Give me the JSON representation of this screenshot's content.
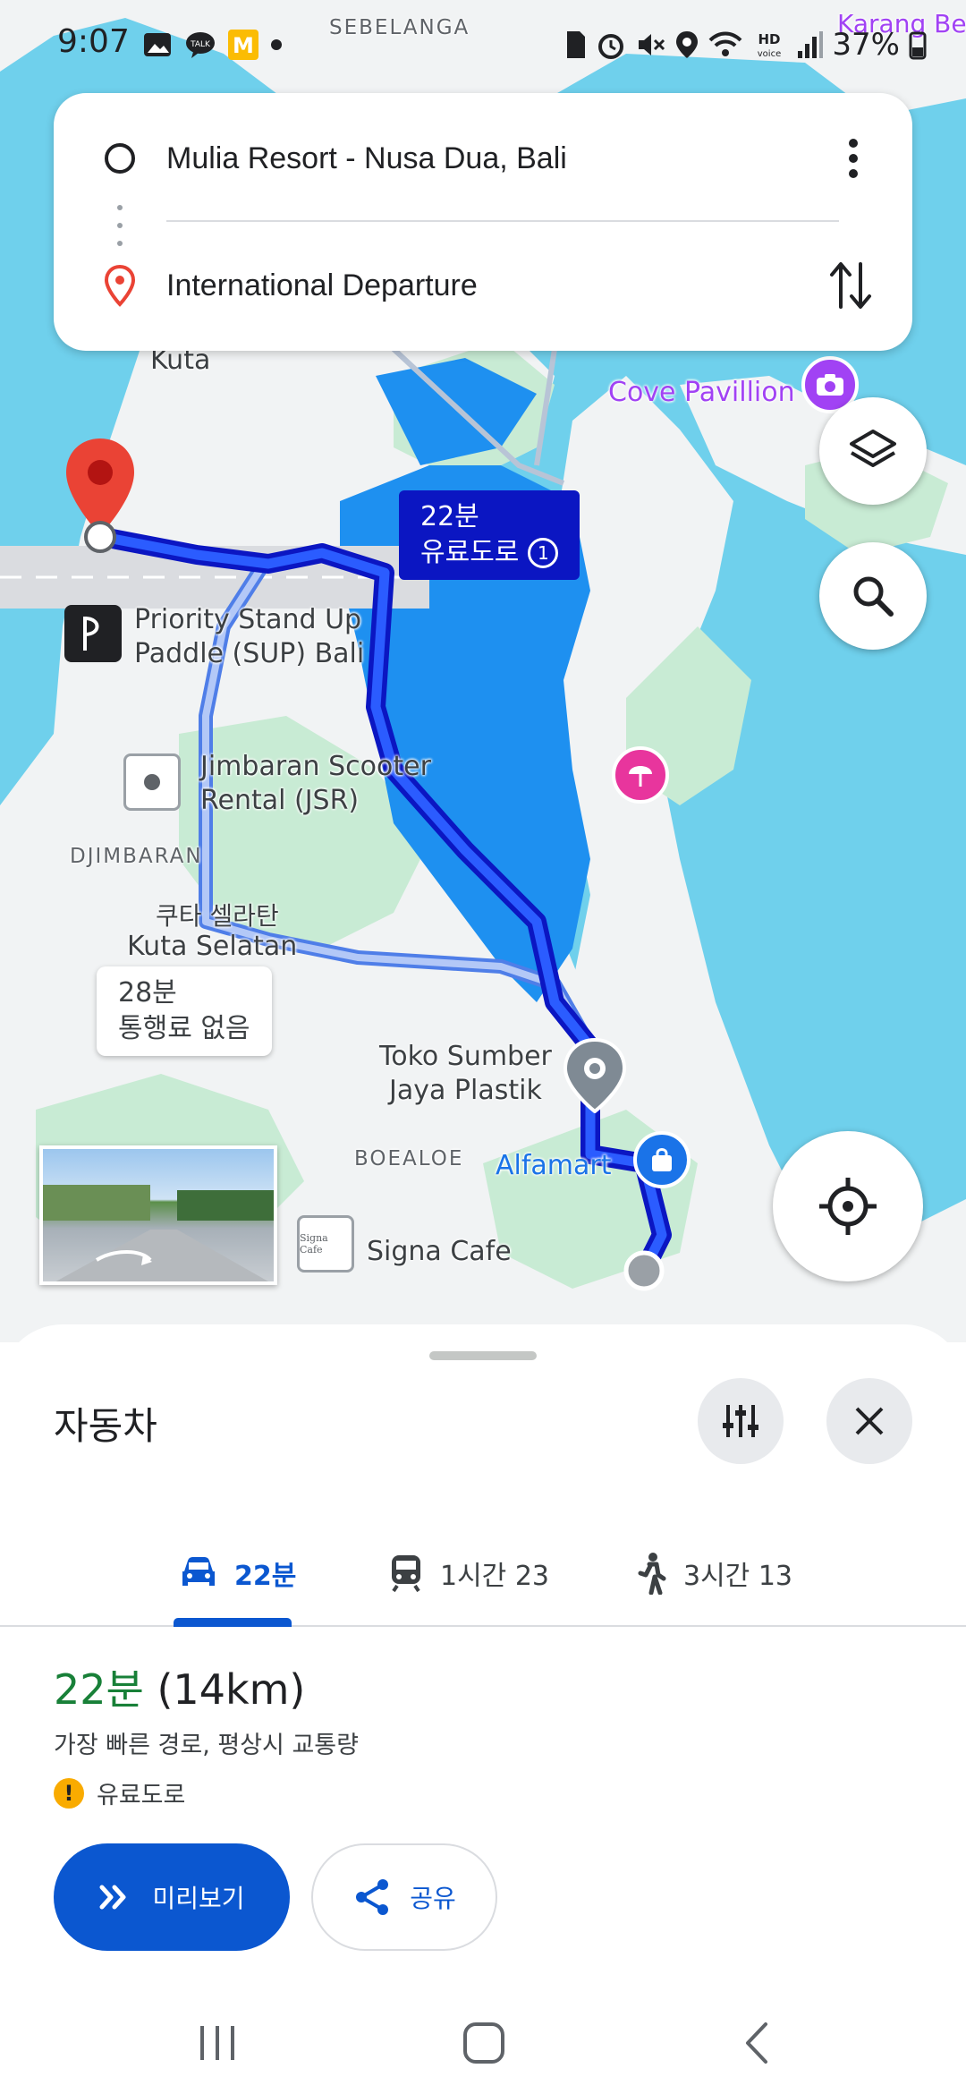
{
  "status_bar": {
    "time": "9:07",
    "battery": "37%",
    "left_icons": [
      "gallery-icon",
      "talk-icon",
      "m-app-icon",
      "dot-icon"
    ],
    "right_icons": [
      "sim-icon",
      "alarm-icon",
      "mute-icon",
      "location-icon",
      "wifi-icon",
      "hd-voice-icon",
      "signal-icon",
      "battery-icon"
    ]
  },
  "directions": {
    "origin": "Mulia Resort - Nusa Dua, Bali",
    "destination": "International Departure"
  },
  "map": {
    "labels": {
      "sebelanga": "SEBELANGA",
      "karang_beach": "Karang Beach",
      "kuta": "Kuta",
      "cove_pavillion": "Cove Pavillion",
      "priority_sup": "Priority Stand Up\nPaddle (SUP) Bali",
      "jimbaran_scooter": "Jimbaran Scooter\nRental (JSR)",
      "djimbaran": "DJIMBARAN",
      "kuta_selatan_kr": "쿠타 셀라탄",
      "kuta_selatan": "Kuta Selatan",
      "toko_sumber": "Toko Sumber\nJaya Plastik",
      "boealoe": "BOEALOE",
      "alfamart": "Alfamart",
      "signa_cafe": "Signa Cafe"
    },
    "route_badge": {
      "time": "22분",
      "toll": "유료도로"
    },
    "alt_badge": {
      "time": "28분",
      "toll": "통행료 없음"
    }
  },
  "sheet": {
    "title": "자동차",
    "tabs": [
      {
        "mode": "car",
        "label": "22분",
        "active": true
      },
      {
        "mode": "transit",
        "label": "1시간 23"
      },
      {
        "mode": "walk",
        "label": "3시간 13"
      }
    ],
    "summary_time": "22분",
    "summary_distance": "(14km)",
    "summary_desc": "가장 빠른 경로, 평상시 교통량",
    "toll_note": "유료도로",
    "preview_label": "미리보기",
    "share_label": "공유"
  },
  "colors": {
    "route": "#0b16c2",
    "accent": "#0b57d0",
    "time_green": "#188038",
    "water": "#6fd0ec"
  }
}
